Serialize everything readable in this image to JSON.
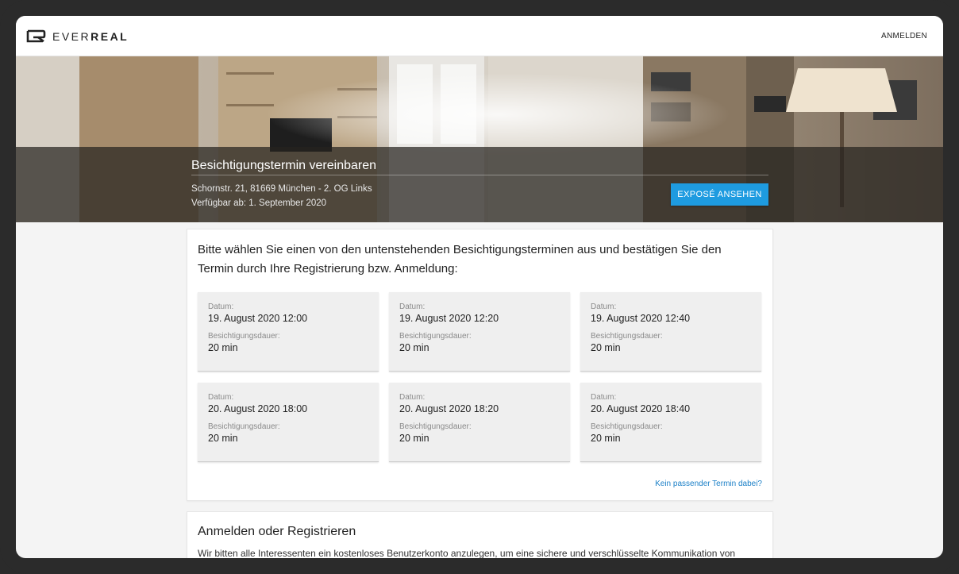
{
  "header": {
    "logo_light": "EVER",
    "logo_bold": "REAL",
    "login_label": "ANMELDEN"
  },
  "hero": {
    "title": "Besichtigungstermin vereinbaren",
    "address": "Schornstr. 21, 81669 München - 2. OG Links",
    "availability": "Verfügbar ab: 1. September 2020",
    "expose_button": "EXPOSÉ ANSEHEN"
  },
  "appointments": {
    "intro": "Bitte wählen Sie einen von den untenstehenden Besichtigungsterminen aus und bestätigen Sie den Termin durch Ihre Registrierung bzw. Anmeldung:",
    "date_label": "Datum:",
    "duration_label": "Besichtigungsdauer:",
    "slots": [
      {
        "date": "19. August 2020 12:00",
        "duration": "20 min"
      },
      {
        "date": "19. August 2020 12:20",
        "duration": "20 min"
      },
      {
        "date": "19. August 2020 12:40",
        "duration": "20 min"
      },
      {
        "date": "20. August 2020 18:00",
        "duration": "20 min"
      },
      {
        "date": "20. August 2020 18:20",
        "duration": "20 min"
      },
      {
        "date": "20. August 2020 18:40",
        "duration": "20 min"
      }
    ],
    "no_match_link": "Kein passender Termin dabei?"
  },
  "login_section": {
    "title": "Anmelden oder Registrieren",
    "text": "Wir bitten alle Interessenten ein kostenloses Benutzerkonto anzulegen, um eine sichere und verschlüsselte Kommunikation von"
  },
  "colors": {
    "accent": "#1e9be0",
    "link": "#1a7fc7"
  }
}
